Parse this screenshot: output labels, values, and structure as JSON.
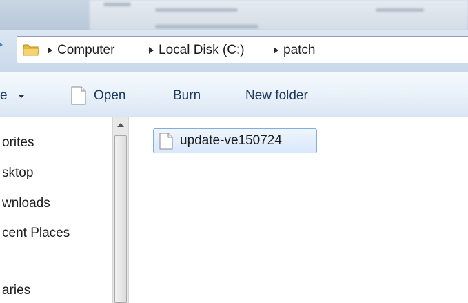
{
  "address_bar": {
    "breadcrumbs": [
      "Computer",
      "Local Disk (C:)",
      "patch"
    ]
  },
  "toolbar": {
    "organize_label": "e",
    "open_label": "Open",
    "burn_label": "Burn",
    "new_folder_label": "New folder"
  },
  "nav_pane": {
    "items": [
      "orites",
      "sktop",
      "wnloads",
      "cent Places",
      "aries"
    ]
  },
  "content": {
    "files": [
      {
        "name": "update-ve150724",
        "selected": true
      }
    ]
  },
  "icons": {
    "folder": "folder-icon",
    "file": "file-icon",
    "back": "back-arrow-icon"
  },
  "colors": {
    "selection_bg": "#d9e8fb",
    "selection_border": "#84acdd",
    "toolbar_text": "#1e395b"
  }
}
